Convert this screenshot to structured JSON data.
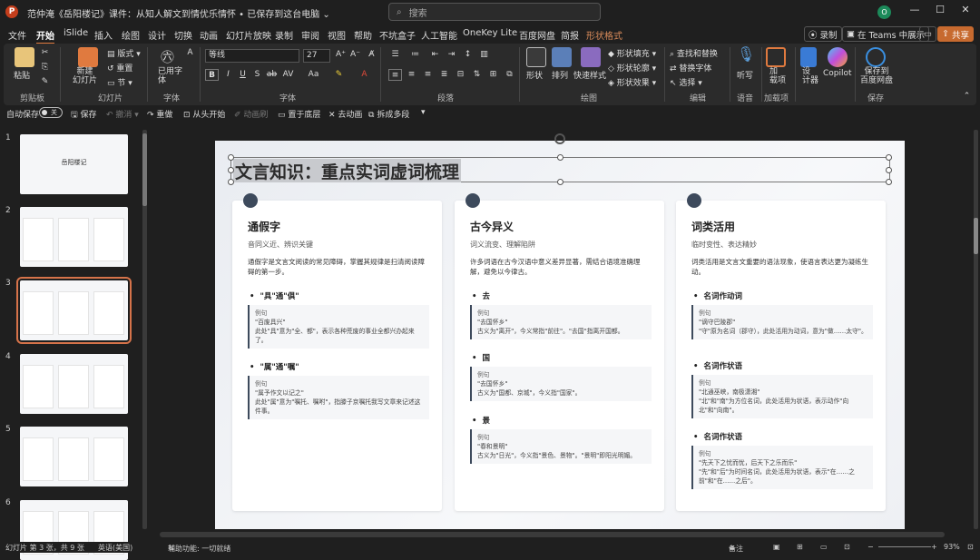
{
  "titlebar": {
    "title": "范仲淹《岳阳楼记》课件：从知人解文到情优乐情怀 • 已保存到这台电脑 ⌄",
    "search": "搜索",
    "avatar": "O",
    "min": "—",
    "max": "☐",
    "close": "✕"
  },
  "menu": {
    "tabs": [
      "文件",
      "开始",
      "iSlide",
      "插入",
      "绘图",
      "设计",
      "切换",
      "动画",
      "幻灯片放映",
      "录制",
      "审阅",
      "视图",
      "帮助",
      "不坑盒子",
      "人工智能",
      "OneKey Lite",
      "百度网盘",
      "简报",
      "形状格式"
    ],
    "record": "录制",
    "teams": "在 Teams 中展示",
    "share": "共享"
  },
  "ribbon": {
    "paste": "粘贴",
    "clipboard": "剪贴板",
    "new_slide": "新建\n幻灯片",
    "layout": "版式",
    "reset": "重置",
    "section": "节",
    "slides_group": "幻灯片",
    "use_font": "已用字\n体",
    "font_group": "字体",
    "font_name": "等线",
    "font_size": "27",
    "font_label": "字体",
    "paragraph": "段落",
    "shape": "形状",
    "arrange": "排列",
    "quick_style": "快速样式",
    "fill": "形状填充",
    "outline": "形状轮廓",
    "effect": "形状效果",
    "drawing": "绘图",
    "find_replace": "查找和替换",
    "replace_font": "替换字体",
    "select": "选择",
    "editing": "编辑",
    "listen": "听写",
    "voice": "语音",
    "addins": "加\n载项",
    "addins_group": "加载项",
    "designer": "设\n计器",
    "copilot": "Copilot",
    "save_baidu": "保存到\n百度网盘",
    "save_group": "保存"
  },
  "qat": {
    "autosave": "自动保存",
    "toggle": "关",
    "save": "保存",
    "undo": "撤消",
    "redo": "重做",
    "from_start": "从头开始",
    "animation_pane": "动画刷",
    "bring_front": "置于底层",
    "remove_anim": "去动画",
    "split": "拆成多段"
  },
  "thumbnails": [
    {
      "num": "1",
      "title": "岳阳楼记"
    },
    {
      "num": "2",
      "title": ""
    },
    {
      "num": "3",
      "title": ""
    },
    {
      "num": "4",
      "title": ""
    },
    {
      "num": "5",
      "title": ""
    },
    {
      "num": "6",
      "title": ""
    }
  ],
  "slide": {
    "title": "文言知识：重点实词虚词梳理",
    "cards": [
      {
        "heading": "通假字",
        "sub": "音同义近、辨识关键",
        "desc": "通假字是文言文阅读的常见障碍，掌握其规律是扫清阅读障碍的第一步。",
        "items": [
          {
            "name": "\"具\"通\"俱\"",
            "ex_label": "例句",
            "ex_quote": "\"百废具兴\"",
            "ex_note": "此处\"具\"意为\"全、都\"，表示各种荒废的事业全都兴办起来了。"
          },
          {
            "name": "\"属\"通\"嘱\"",
            "ex_label": "例句",
            "ex_quote": "\"属予作文以记之\"",
            "ex_note": "此处\"属\"意为\"嘱托、嘱咐\"，指滕子京嘱托我写文章来记述这件事。"
          }
        ]
      },
      {
        "heading": "古今异义",
        "sub": "词义流变、理解陷阱",
        "desc": "许多词语在古今汉语中意义差异显著，需结合语境准确理解，避免以今律古。",
        "items": [
          {
            "name": "去",
            "ex_label": "例句",
            "ex_quote": "\"去国怀乡\"",
            "ex_note": "古义为\"离开\"，今义常指\"前往\"。\"去国\"指离开国都。"
          },
          {
            "name": "国",
            "ex_label": "例句",
            "ex_quote": "\"去国怀乡\"",
            "ex_note": "古义为\"国都、京城\"，今义指\"国家\"。"
          },
          {
            "name": "景",
            "ex_label": "例句",
            "ex_quote": "\"春和景明\"",
            "ex_note": "古义为\"日光\"，今义指\"景色、景物\"。\"景明\"即阳光明媚。"
          }
        ]
      },
      {
        "heading": "词类活用",
        "sub": "临时变性、表达精妙",
        "desc": "词类活用是文言文重要的语法现象，使语言表达更为凝练生动。",
        "items": [
          {
            "name": "名词作动词",
            "ex_label": "例句",
            "ex_quote": "\"谪守巴陵郡\"",
            "ex_note": "\"守\"原为名词（郡守），此处活用为动词，意为\"做……太守\"。"
          },
          {
            "name": "名词作状语",
            "ex_label": "例句",
            "ex_quote": "\"北通巫峡，南极潇湘\"",
            "ex_note": "\"北\"和\"南\"为方位名词，此处活用为状语，表示动作\"向北\"和\"向南\"。"
          },
          {
            "name": "名词作状语",
            "ex_label": "例句",
            "ex_quote": "\"先天下之忧而忧，后天下之乐而乐\"",
            "ex_note": "\"先\"和\"后\"为时间名词，此处活用为状语，表示\"在……之前\"和\"在……之后\"。"
          }
        ]
      }
    ]
  },
  "status": {
    "slide_info": "幻灯片 第 3 张，共 9 张",
    "language": "英语(美国)",
    "accessibility": "辅助功能: 一切就绪",
    "notes": "备注",
    "zoom": "93%"
  }
}
